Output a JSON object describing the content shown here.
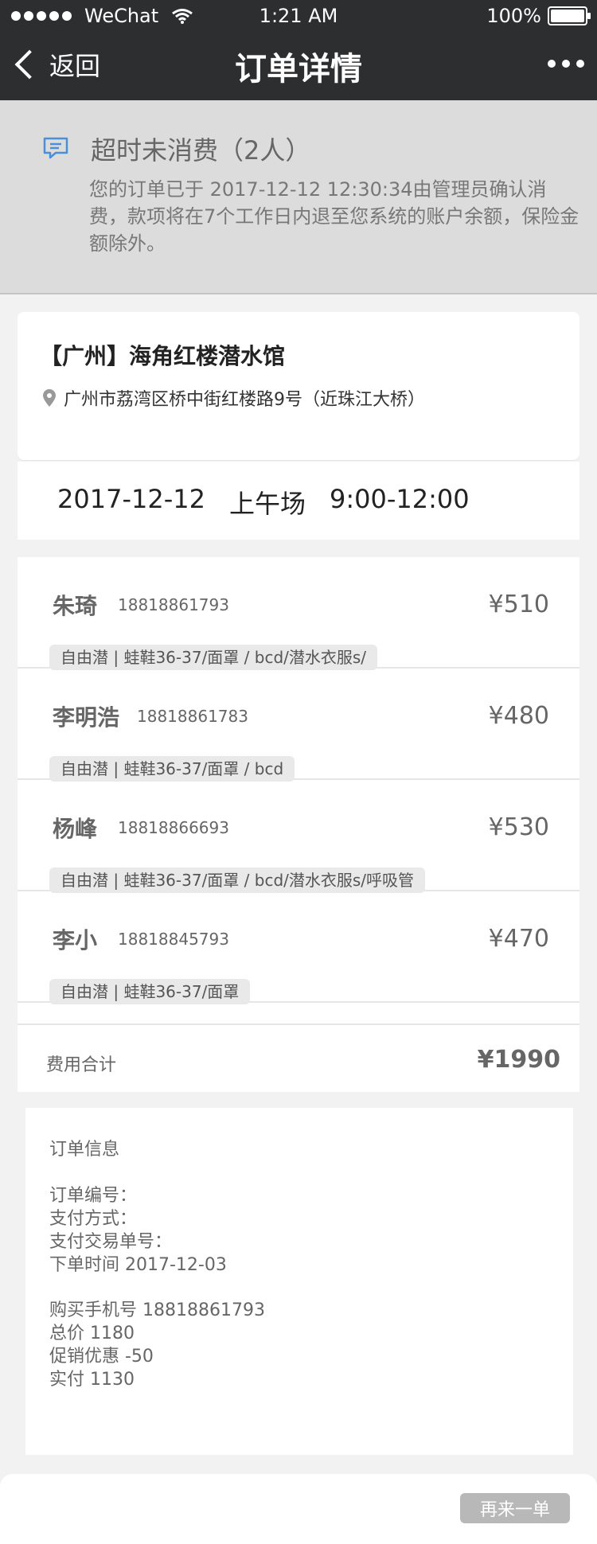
{
  "status_bar": {
    "carrier": "WeChat",
    "time": "1:21 AM",
    "battery": "100%"
  },
  "nav": {
    "back_label": "返回",
    "title": "订单详情"
  },
  "notice": {
    "title": "超时未消费（2人）",
    "message": "您的订单已于 2017-12-12 12:30:34由管理员确认消费，款项将在7个工作日内退至您系统的账户余额，保险金额除外。"
  },
  "venue": {
    "name": "【广州】海角红楼潜水馆",
    "address": "广州市荔湾区桥中街红楼路9号（近珠江大桥）"
  },
  "session": {
    "date": "2017-12-12",
    "slot": "上午场",
    "time": "9:00-12:00"
  },
  "participants": [
    {
      "name": "朱琦",
      "phone": "18818861793",
      "price": "¥510",
      "items": "自由潜 | 蛙鞋36-37/面罩 / bcd/潜水衣服s/"
    },
    {
      "name": "李明浩",
      "phone": "18818861783",
      "price": "¥480",
      "items": "自由潜 | 蛙鞋36-37/面罩 / bcd"
    },
    {
      "name": "杨峰",
      "phone": "18818866693",
      "price": "¥530",
      "items": "自由潜 | 蛙鞋36-37/面罩 / bcd/潜水衣服s/呼吸管"
    },
    {
      "name": "李小",
      "phone": "18818845793",
      "price": "¥470",
      "items": "自由潜 | 蛙鞋36-37/面罩"
    }
  ],
  "total": {
    "label": "费用合计",
    "value": "¥1990"
  },
  "order_info": {
    "title": "订单信息",
    "order_no": "订单编号：",
    "pay_method": "支付方式：",
    "pay_txn": "支付交易单号：",
    "order_time": "下单时间  2017-12-03",
    "buyer_phone": "购买手机号  18818861793",
    "total_price": "总价 1180",
    "discount": "促销优惠  -50",
    "paid": "实付 1130"
  },
  "bottom": {
    "reorder_label": "再来一单"
  },
  "colors": {
    "header_bg": "#2d2e2f",
    "notice_bg": "#dcdcdc",
    "notice_icon": "#4a90d9",
    "button_bg": "#b8b8b8"
  },
  "icons": {
    "back": "chevron-left-icon",
    "more": "more-dots-icon",
    "notice": "message-icon",
    "location": "location-pin-icon",
    "wifi": "wifi-icon",
    "battery": "battery-icon"
  }
}
